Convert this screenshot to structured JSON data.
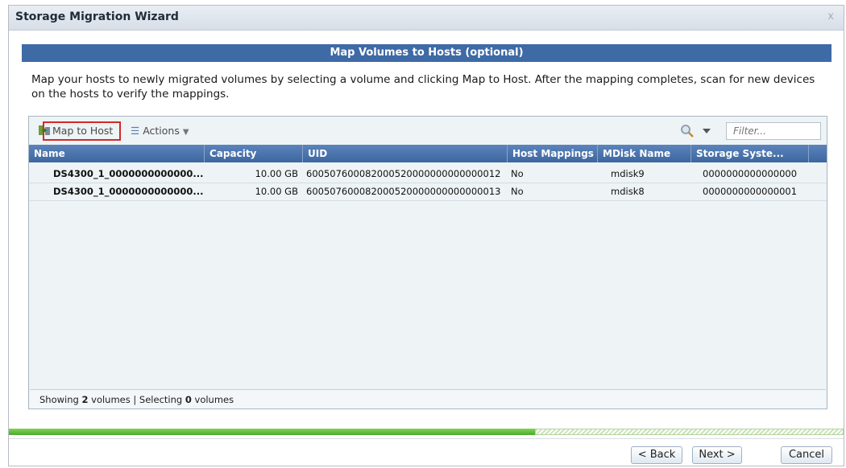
{
  "window": {
    "title": "Storage Migration Wizard",
    "close_label": "x"
  },
  "step": {
    "title": "Map Volumes to Hosts (optional)",
    "description": "Map your hosts to newly migrated volumes by selecting a volume and clicking Map to Host. After the mapping completes, scan for new devices on the hosts to verify the mappings."
  },
  "toolbar": {
    "map_to_host_label": "Map to Host",
    "actions_label": "Actions",
    "filter_placeholder": "Filter..."
  },
  "table": {
    "columns": [
      "Name",
      "Capacity",
      "UID",
      "Host Mappings",
      "MDisk Name",
      "Storage Syste..."
    ],
    "rows": [
      {
        "name": "DS4300_1_0000000000000...",
        "capacity": "10.00 GB",
        "uid": "600507600082000520000000000000012",
        "host_mappings": "No",
        "mdisk_name": "mdisk9",
        "storage_system": "0000000000000000"
      },
      {
        "name": "DS4300_1_0000000000000...",
        "capacity": "10.00 GB",
        "uid": "600507600082000520000000000000013",
        "host_mappings": "No",
        "mdisk_name": "mdisk8",
        "storage_system": "0000000000000001"
      }
    ]
  },
  "status": {
    "prefix": "Showing ",
    "showing_count": "2",
    "middle": " volumes | Selecting ",
    "selecting_count": "0",
    "suffix": " volumes"
  },
  "progress": {
    "fraction": 0.63,
    "fill_color": "#5bb83a"
  },
  "footer": {
    "back_label": "< Back",
    "next_label": "Next >",
    "cancel_label": "Cancel"
  },
  "colors": {
    "banner": "#3e6aa6",
    "table_header": "#4a74ad",
    "highlight_border": "#d22a2a"
  },
  "icons": {
    "map": "map-to-host-icon",
    "actions": "list-icon",
    "search": "magnifier-icon",
    "dropdown": "chevron-down-icon"
  }
}
